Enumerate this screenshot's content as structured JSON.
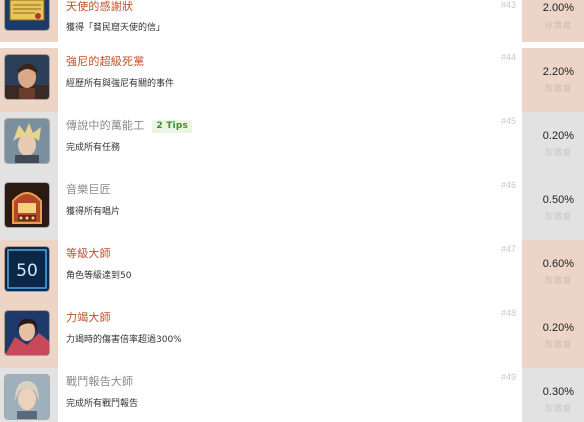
{
  "achievements": [
    {
      "title": "天使的感謝狀",
      "description": "獲得「貧民窟天使的信」",
      "number": "#43",
      "percent": "2.00%",
      "rarity_label": "珍貴度",
      "style": "rare",
      "icon": "letter-icon",
      "tips": null
    },
    {
      "title": "強尼的超級死黨",
      "description": "經歷所有與強尼有關的事件",
      "number": "#44",
      "percent": "2.20%",
      "rarity_label": "珍貴度",
      "style": "rare",
      "icon": "johnny-portrait-icon",
      "tips": null
    },
    {
      "title": "傳說中的萬能工",
      "description": "完成所有任務",
      "number": "#45",
      "percent": "0.20%",
      "rarity_label": "珍貴度",
      "style": "common",
      "icon": "cloud-portrait-icon",
      "tips": "2 Tips"
    },
    {
      "title": "音樂巨匠",
      "description": "獲得所有唱片",
      "number": "#46",
      "percent": "0.50%",
      "rarity_label": "珍貴度",
      "style": "common",
      "icon": "jukebox-icon",
      "tips": null
    },
    {
      "title": "等級大師",
      "description": "角色等級達到50",
      "number": "#47",
      "percent": "0.60%",
      "rarity_label": "珍貴度",
      "style": "rare",
      "icon": "level-50-icon",
      "tips": null
    },
    {
      "title": "力竭大師",
      "description": "力竭時的傷害倍率超過300%",
      "number": "#48",
      "percent": "0.20%",
      "rarity_label": "珍貴度",
      "style": "rare",
      "icon": "tifa-portrait-icon",
      "tips": null
    },
    {
      "title": "戰鬥報告大師",
      "description": "完成所有戰鬥報告",
      "number": "#49",
      "percent": "0.30%",
      "rarity_label": "珍貴度",
      "style": "common",
      "icon": "aerith-portrait-icon",
      "tips": null
    }
  ]
}
